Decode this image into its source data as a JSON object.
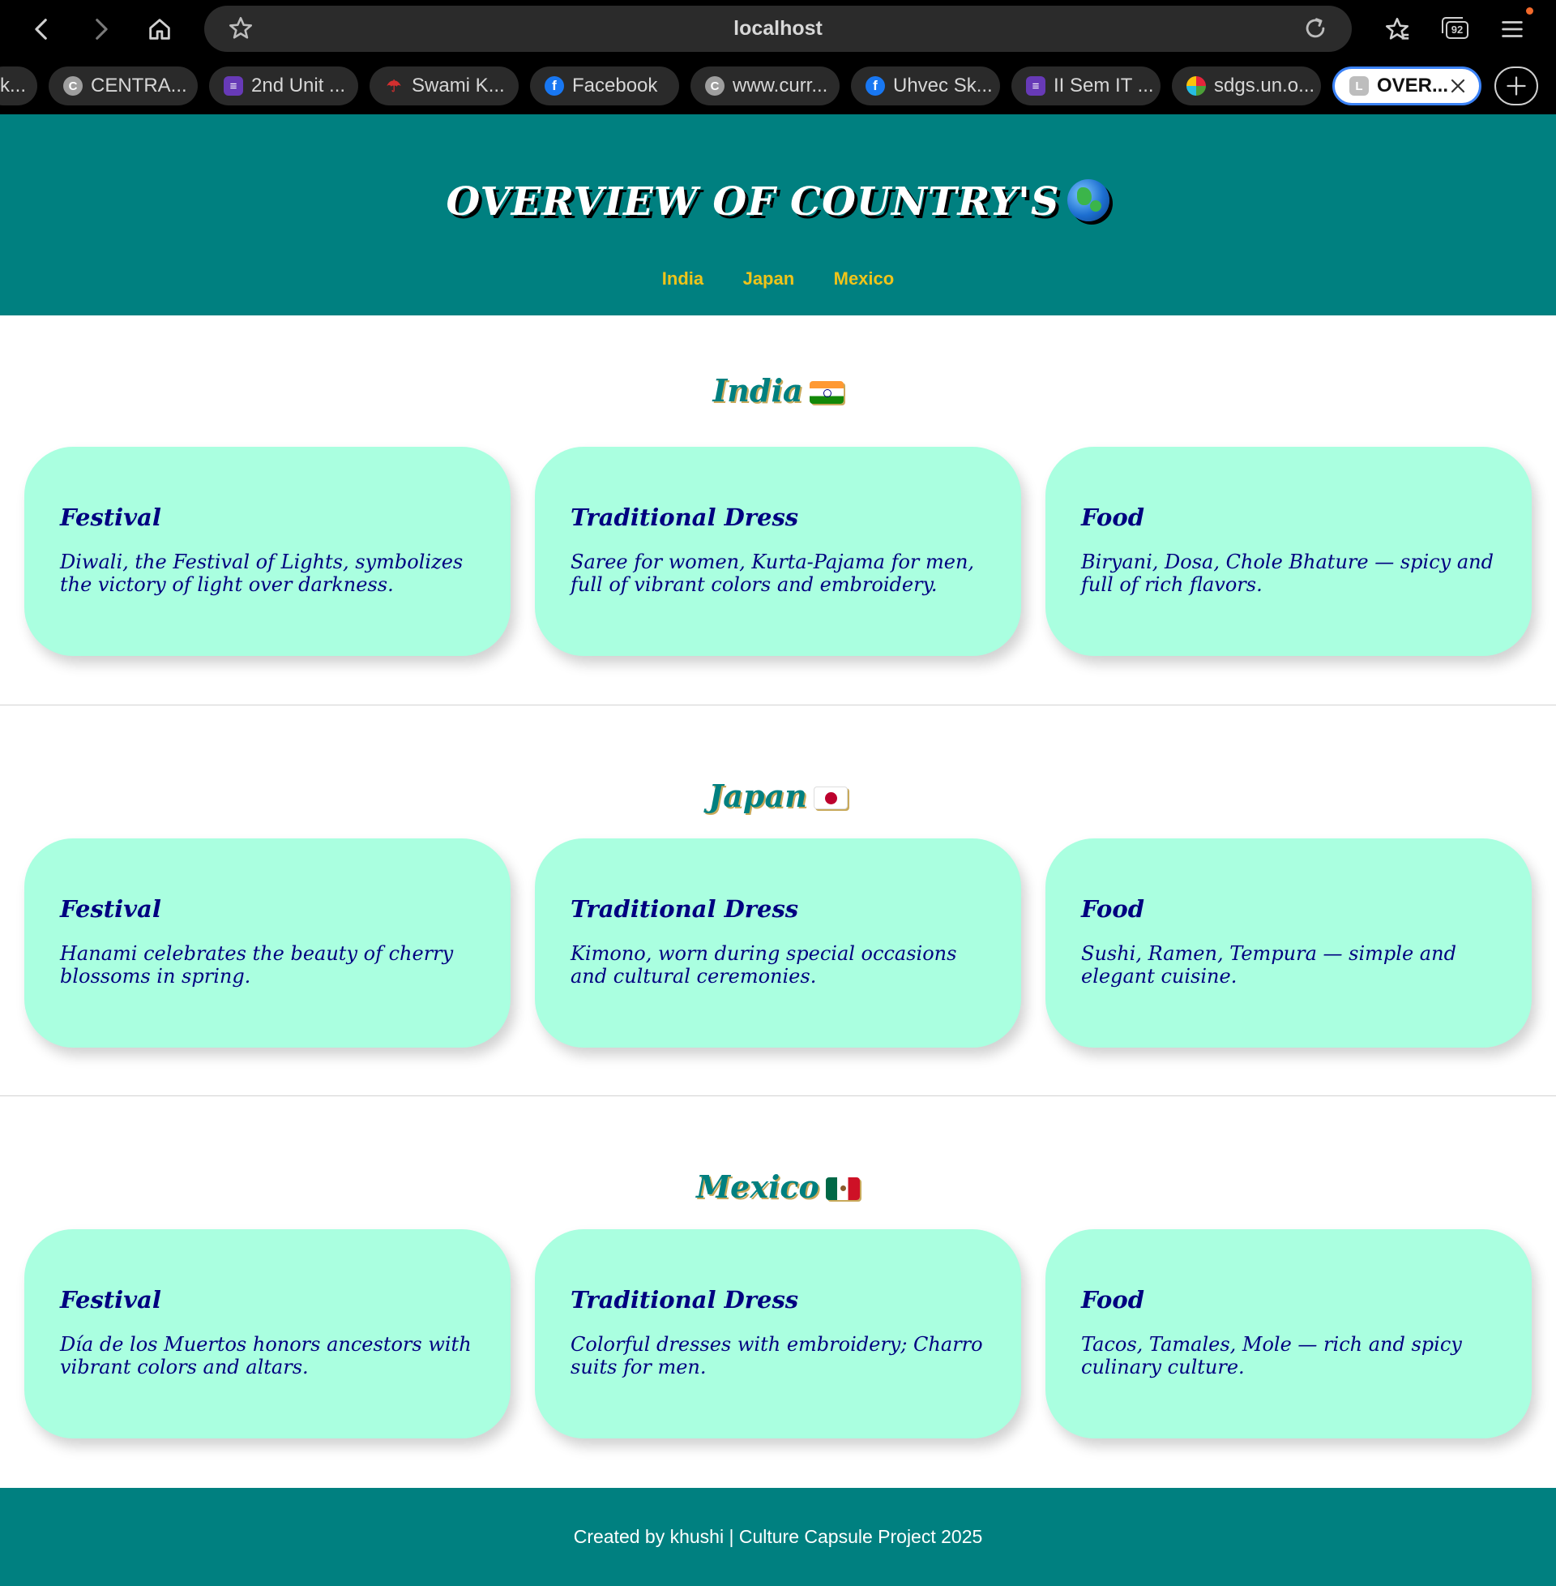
{
  "browser": {
    "url": "localhost",
    "tab_count": "92",
    "tabs": [
      {
        "label": "k...",
        "icon": "tab-favicon"
      },
      {
        "label": "CENTRA...",
        "icon": "c-favicon"
      },
      {
        "label": "2nd Unit ...",
        "icon": "forms-favicon"
      },
      {
        "label": "Swami K...",
        "icon": "umbrella-favicon"
      },
      {
        "label": "Facebook",
        "icon": "facebook-favicon"
      },
      {
        "label": "www.curr...",
        "icon": "c-favicon"
      },
      {
        "label": "Uhvec Sk...",
        "icon": "facebook-favicon"
      },
      {
        "label": "II Sem IT ...",
        "icon": "forms-favicon"
      },
      {
        "label": "sdgs.un.o...",
        "icon": "sdg-favicon"
      },
      {
        "label": "OVER...",
        "icon": "l-favicon"
      }
    ]
  },
  "header": {
    "title": "OVERVIEW OF COUNTRY'S",
    "nav": [
      "India",
      "Japan",
      "Mexico"
    ]
  },
  "countries": [
    {
      "name": "India",
      "cards": [
        {
          "title": "Festival",
          "text": "Diwali, the Festival of Lights, symbolizes the victory of light over darkness."
        },
        {
          "title": "Traditional Dress",
          "text": "Saree for women, Kurta-Pajama for men, full of vibrant colors and embroidery."
        },
        {
          "title": "Food",
          "text": "Biryani, Dosa, Chole Bhature — spicy and full of rich flavors."
        }
      ]
    },
    {
      "name": "Japan",
      "cards": [
        {
          "title": "Festival",
          "text": "Hanami celebrates the beauty of cherry blossoms in spring."
        },
        {
          "title": "Traditional Dress",
          "text": "Kimono, worn during special occasions and cultural ceremonies."
        },
        {
          "title": "Food",
          "text": "Sushi, Ramen, Tempura — simple and elegant cuisine."
        }
      ]
    },
    {
      "name": "Mexico",
      "cards": [
        {
          "title": "Festival",
          "text": "Día de los Muertos honors ancestors with vibrant colors and altars."
        },
        {
          "title": "Traditional Dress",
          "text": "Colorful dresses with embroidery; Charro suits for men."
        },
        {
          "title": "Food",
          "text": "Tacos, Tamales, Mole — rich and spicy culinary culture."
        }
      ]
    }
  ],
  "footer": {
    "text": "Created by khushi | Culture Capsule Project 2025"
  },
  "colors": {
    "header_bg": "#008080",
    "nav_link": "#f0c419",
    "card_bg": "#aaffe0",
    "card_text": "#000080",
    "country_heading": "#008080"
  }
}
